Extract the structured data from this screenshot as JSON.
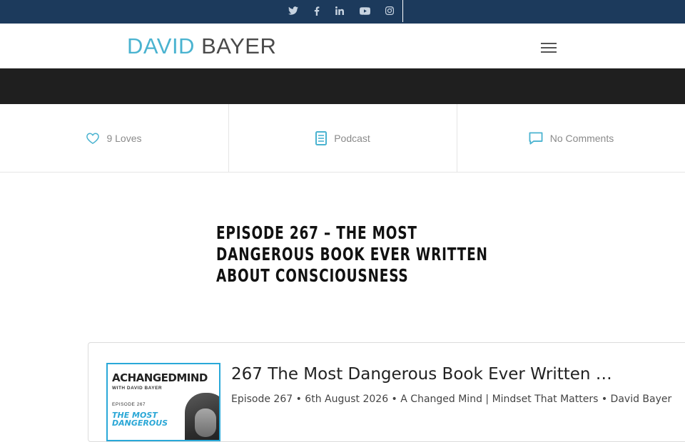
{
  "topbar": {
    "social": [
      {
        "name": "twitter",
        "glyph": "🐦"
      },
      {
        "name": "facebook",
        "glyph": "f"
      },
      {
        "name": "linkedin",
        "glyph": "in"
      },
      {
        "name": "youtube",
        "glyph": "▶"
      },
      {
        "name": "instagram",
        "glyph": "◎"
      }
    ]
  },
  "header": {
    "logo_first": "DAVID",
    "logo_last": "BAYER"
  },
  "meta": {
    "loves": "9 Loves",
    "category": "Podcast",
    "comments": "No Comments"
  },
  "post": {
    "title": "Episode 267 – The Most Dangerous Book Ever Written About Consciousness"
  },
  "player": {
    "cover": {
      "title": "ACHANGEDMIND",
      "with": "WITH DAVID BAYER",
      "episode": "EPISODE 267",
      "subtitle": "THE MOST DANGEROUS"
    },
    "episode_title": "267 The Most Dangerous Book Ever Written …",
    "episode_meta": "Episode 267 • 6th August 2026 • A Changed Mind | Mindset That Matters • David Bayer"
  },
  "colors": {
    "topbar": "#1c3a5c",
    "accent": "#4ab3d0",
    "darkband": "#1f1f1f"
  }
}
